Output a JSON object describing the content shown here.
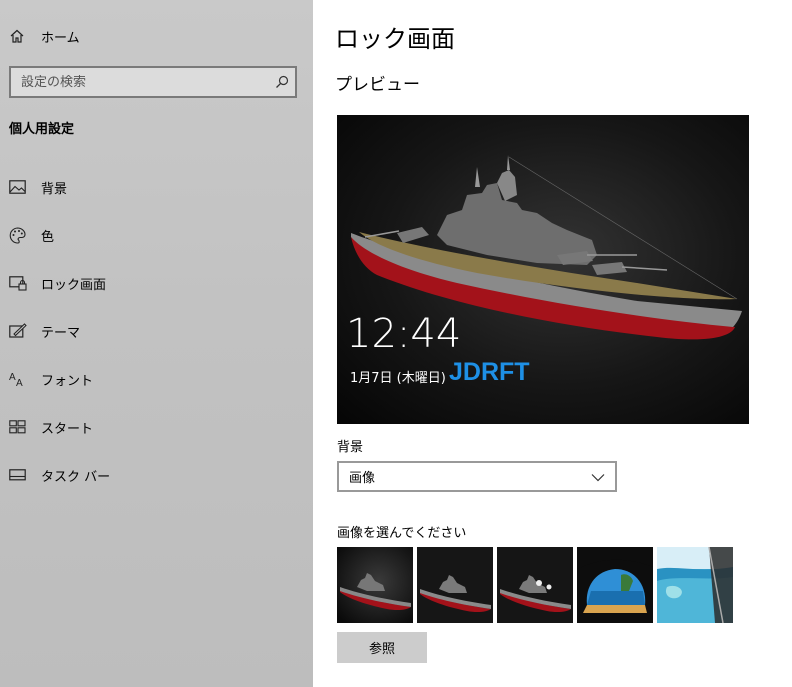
{
  "sidebar": {
    "home_label": "ホーム",
    "search_placeholder": "設定の検索",
    "section_title": "個人用設定",
    "items": [
      {
        "label": "背景",
        "icon": "image-icon"
      },
      {
        "label": "色",
        "icon": "palette-icon"
      },
      {
        "label": "ロック画面",
        "icon": "lock-screen-icon"
      },
      {
        "label": "テーマ",
        "icon": "theme-icon"
      },
      {
        "label": "フォント",
        "icon": "font-icon"
      },
      {
        "label": "スタート",
        "icon": "start-icon"
      },
      {
        "label": "タスク バー",
        "icon": "taskbar-icon"
      }
    ]
  },
  "main": {
    "title": "ロック画面",
    "preview_heading": "プレビュー",
    "preview": {
      "time": "12:44",
      "date": "1月7日 (木曜日)",
      "brand": "JDRFT",
      "brand_color": "#1e90e6"
    },
    "background_label": "背景",
    "background_value": "画像",
    "choose_label": "画像を選んでください",
    "thumbnails": [
      "battleship-1",
      "battleship-2",
      "battleship-3",
      "beach-cave",
      "aerial-coast"
    ],
    "browse_label": "参照"
  }
}
